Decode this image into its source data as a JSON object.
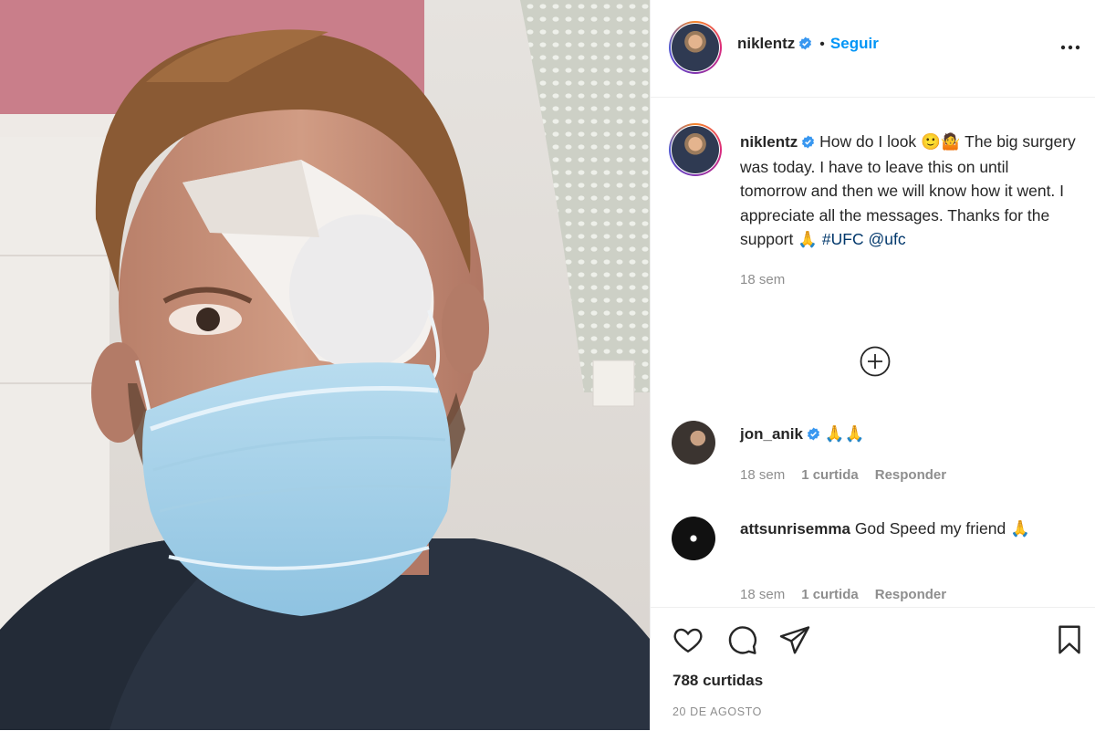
{
  "post": {
    "author": "niklentz",
    "follow_label": "Seguir",
    "separator": "•"
  },
  "caption": {
    "author": "niklentz",
    "text": " How do I look 🙂🤷 The big surgery was today. I have to leave this on until tomorrow and then we will know how it went. I appreciate all the messages. Thanks for the support 🙏 ",
    "hashtag": "#UFC",
    "mention": "@ufc",
    "age": "18 sem"
  },
  "comments": [
    {
      "author": "jon_anik",
      "verified": true,
      "text": "🙏🙏",
      "age": "18 sem",
      "likes": "1 curtida",
      "reply_label": "Responder"
    },
    {
      "author": "attsunrisemma",
      "verified": false,
      "text": "God Speed my friend 🙏",
      "age": "18 sem",
      "likes": "1 curtida",
      "reply_label": "Responder"
    }
  ],
  "stats": {
    "likes": "788 curtidas",
    "date": "20 DE AGOSTO"
  },
  "icons": {
    "verified": "verified-badge-icon",
    "more": "more-options-icon",
    "load_more": "plus-circle-icon",
    "like": "heart-icon",
    "comment": "comment-bubble-icon",
    "share": "paper-plane-icon",
    "save": "bookmark-icon"
  },
  "colors": {
    "accent": "#0095f6",
    "text": "#262626",
    "muted": "#8e8e8e",
    "link": "#00376b",
    "verified": "#3897f0"
  }
}
